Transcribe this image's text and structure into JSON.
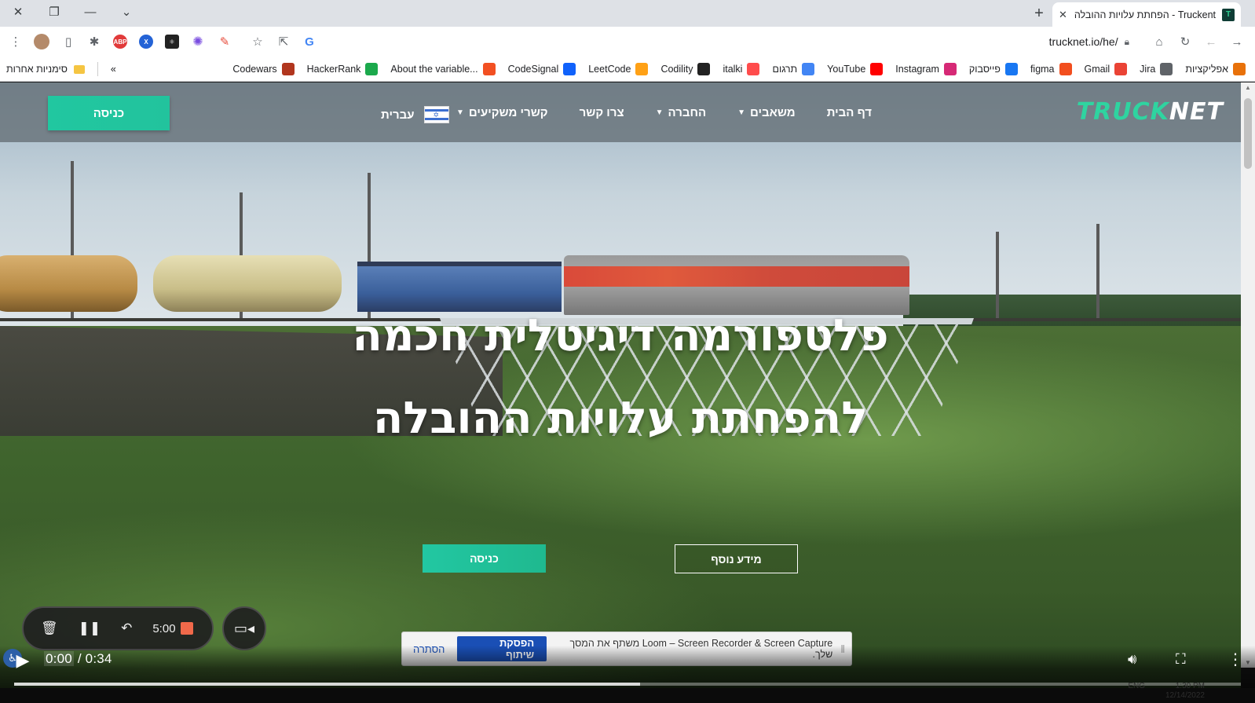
{
  "browser": {
    "tab": {
      "title": "Truckent - הפחתת עלויות ההובלה",
      "favicon_text": "T"
    },
    "address_url": "trucknet.io/he/",
    "bookmarks": [
      {
        "label": "אפליקציות",
        "icon": "apps-grid-icon",
        "color": "#e8710a"
      },
      {
        "label": "Jira",
        "icon": "globe-icon",
        "color": "#5f6368"
      },
      {
        "label": "Gmail",
        "icon": "gmail-icon",
        "color": "#ea4335"
      },
      {
        "label": "figma",
        "icon": "figma-icon",
        "color": "#f24e1e"
      },
      {
        "label": "פייסבוק",
        "icon": "facebook-icon",
        "color": "#1877f2"
      },
      {
        "label": "Instagram",
        "icon": "instagram-icon",
        "color": "#d62976"
      },
      {
        "label": "YouTube",
        "icon": "youtube-icon",
        "color": "#ff0000"
      },
      {
        "label": "תרגום",
        "icon": "translate-icon",
        "color": "#4285f4"
      },
      {
        "label": "italki",
        "icon": "italki-icon",
        "color": "#ff4c4c"
      },
      {
        "label": "Codility",
        "icon": "codility-icon",
        "color": "#222222"
      },
      {
        "label": "LeetCode",
        "icon": "leetcode-icon",
        "color": "#ffa116"
      },
      {
        "label": "CodeSignal",
        "icon": "codesignal-icon",
        "color": "#1062fb"
      },
      {
        "label": "About the variable...",
        "icon": "microsoft-icon",
        "color": "#f25022"
      },
      {
        "label": "HackerRank",
        "icon": "hackerrank-icon",
        "color": "#1ba94c"
      },
      {
        "label": "Codewars",
        "icon": "codewars-icon",
        "color": "#b1361e"
      }
    ],
    "bookmarks_overflow": "«",
    "other_bookmarks": "סימניות אחרות"
  },
  "site": {
    "logo_a": "TRUCK",
    "logo_b": "NET",
    "nav": [
      {
        "label": "דף הבית",
        "has_dropdown": false
      },
      {
        "label": "משאבים",
        "has_dropdown": true
      },
      {
        "label": "החברה",
        "has_dropdown": true
      },
      {
        "label": "צרו קשר",
        "has_dropdown": false
      },
      {
        "label": "קשרי משקיעים",
        "has_dropdown": true
      }
    ],
    "language": "עברית",
    "login_button": "כניסה",
    "hero_line_1": "פלטפורמה דיגיטלית חכמה",
    "hero_line_2": "להפחתת עלויות ההובלה",
    "hero_enter": "כניסה",
    "hero_more": "מידע נוסף"
  },
  "loom": {
    "timer": "5:00",
    "share_message": "Loom – Screen Recorder & Screen Capture משתף את המסך שלך.",
    "stop_sharing": "הפסקת שיתוף",
    "hide": "הסתרה"
  },
  "player": {
    "current_time": "0:00",
    "duration": "0:34",
    "separator": " / ",
    "buffered_fraction": 0.51,
    "clock_time": "1:30 PM",
    "clock_date": "12/14/2022",
    "lang": "ENG"
  },
  "colors": {
    "accent": "#22c7a0",
    "stop_button": "#1a4fb5",
    "record": "#f0694a"
  }
}
